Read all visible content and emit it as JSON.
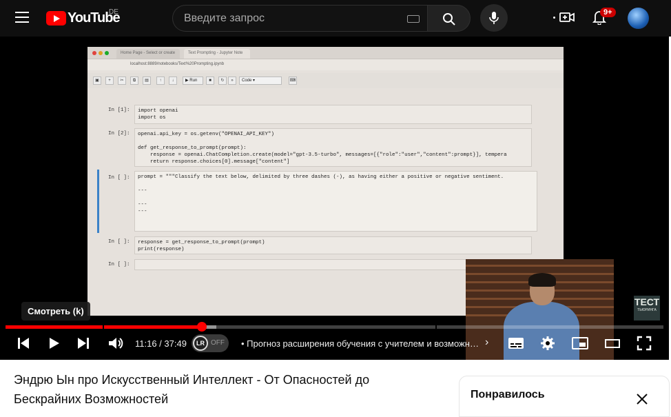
{
  "header": {
    "logo_text": "YouTube",
    "region": "DE",
    "search_placeholder": "Введите запрос",
    "notifications_badge": "9+"
  },
  "slide": {
    "tabs": [
      "Home Page - Select or create",
      "Text Prompting - Jupyter Note"
    ],
    "url": "localhost:8889/notebooks/Text%20Prompting.ipynb",
    "run_label": "Run",
    "cell_type": "Code",
    "cells": [
      {
        "prompt": "In [1]:",
        "code": "import openai\nimport os"
      },
      {
        "prompt": "In [2]:",
        "code": "openai.api_key = os.getenv(\"OPENAI_API_KEY\")\n\ndef get_response_to_prompt(prompt):\n    response = openai.ChatCompletion.create(model=\"gpt-3.5-turbo\", messages=[{\"role\":\"user\",\"content\":prompt}], tempera\n    return response.choices[0].message[\"content\"]"
      },
      {
        "prompt": "In [ ]:",
        "code": "prompt = \"\"\"Classify the text below, delimited by three dashes (-), as having either a positive or negative sentiment.\n\n---\n\n---\n---"
      },
      {
        "prompt": "In [ ]:",
        "code": "response = get_response_to_prompt(prompt)\nprint(response)"
      },
      {
        "prompt": "In [ ]:",
        "code": ""
      }
    ]
  },
  "brand_watermark": {
    "title": "ТЕСТ",
    "subtitle": "ТЬЮРИНГА"
  },
  "player": {
    "tooltip": "Смотреть (k)",
    "current_time": "11:16",
    "duration": "37:49",
    "time_display": "11:16 / 37:49",
    "progress_played_fraction": 0.298,
    "progress_buffered_fraction": 0.32,
    "lr_label": "LR",
    "lr_state": "OFF",
    "chapter_title": "• Прогноз расширения обучения с учителем и возможно..."
  },
  "video": {
    "title": "Эндрю Ын про Искусственный Интеллект - От Опасностей до Бескрайних Возможностей"
  },
  "liked_panel": {
    "title": "Понравилось"
  },
  "colors": {
    "accent": "#ff0000",
    "background": "#0f0f0f",
    "badge": "#cc0000"
  }
}
